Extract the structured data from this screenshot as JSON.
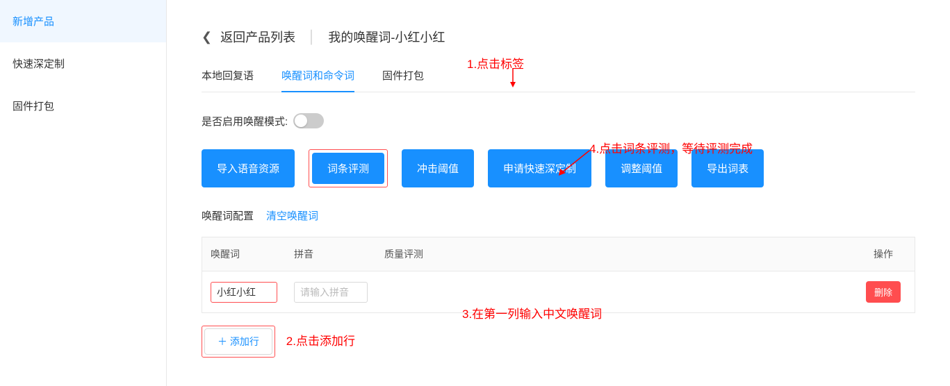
{
  "sidebar": {
    "items": [
      {
        "label": "新增产品",
        "active": true
      },
      {
        "label": "快速深定制",
        "active": false
      },
      {
        "label": "固件打包",
        "active": false
      }
    ]
  },
  "header": {
    "back": "返回产品列表",
    "title": "我的唤醒词-小红小红"
  },
  "tabs": [
    {
      "label": "本地回复语",
      "active": false
    },
    {
      "label": "唤醒词和命令词",
      "active": true
    },
    {
      "label": "固件打包",
      "active": false
    }
  ],
  "toggle": {
    "label": "是否启用唤醒模式:"
  },
  "buttons": {
    "import": "导入语音资源",
    "eval": "词条评测",
    "threshold": "冲击阈值",
    "apply": "申请快速深定制",
    "adjust": "调整阈值",
    "export": "导出词表"
  },
  "config": {
    "label": "唤醒词配置",
    "clear": "清空唤醒词"
  },
  "table": {
    "headers": {
      "word": "唤醒词",
      "pinyin": "拼音",
      "quality": "质量评测",
      "action": "操作"
    },
    "row": {
      "word_value": "小红小红",
      "pinyin_placeholder": "请输入拼音",
      "delete": "删除"
    }
  },
  "add_row": "＋ 添加行",
  "annotations": {
    "a1": "1.点击标签",
    "a2": "2.点击添加行",
    "a3": "3.在第一列输入中文唤醒词",
    "a4": "4.点击词条评测，等待评测完成"
  }
}
